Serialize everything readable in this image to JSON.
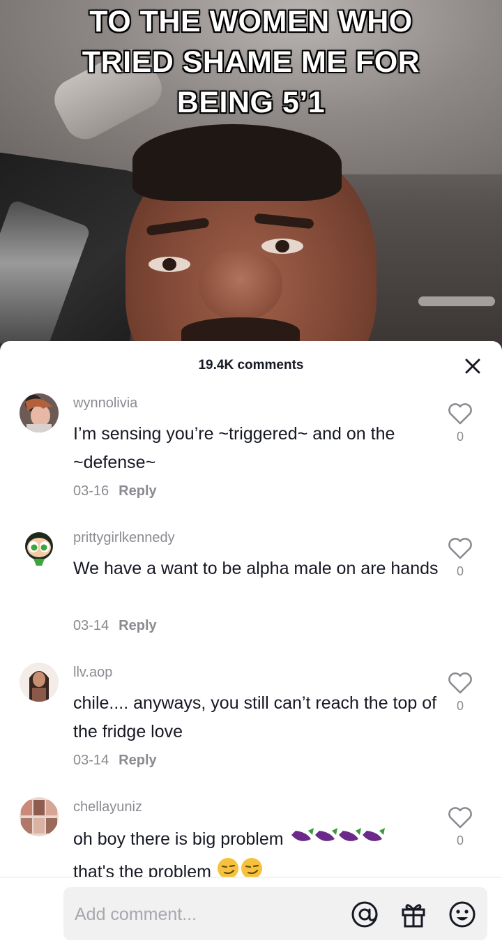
{
  "video": {
    "caption_lines": [
      "TO THE WOMEN WHO",
      "TRIED SHAME ME FOR",
      "BEING 5’1"
    ]
  },
  "comments_panel": {
    "count_label": "19.4K comments",
    "close_icon": "close-icon",
    "comments": [
      {
        "username": "wynnolivia",
        "text": "I’m sensing you’re ~triggered~ and on the ~defense~",
        "date": "03-16",
        "reply_label": "Reply",
        "likes": "0"
      },
      {
        "username": "prittygirlkennedy",
        "text": "We have a want to be alpha male on are hands",
        "date": "03-14",
        "reply_label": "Reply",
        "likes": "0"
      },
      {
        "username": "llv.aop",
        "text": "chile.... anyways, you still can’t reach the top of the fridge love",
        "date": "03-14",
        "reply_label": "Reply",
        "likes": "0"
      },
      {
        "username": "chellayuniz",
        "text_before": "oh boy there is big problem",
        "text_after": "that's the problem",
        "emoji_1": "eggplant-emoji",
        "emoji_2": "smirk-emoji",
        "likes": "0"
      }
    ]
  },
  "bottom_bar": {
    "placeholder": "Add comment...",
    "icons": [
      "at-icon",
      "gift-icon",
      "emoji-icon"
    ]
  },
  "colors": {
    "text_primary": "#161823",
    "text_secondary": "#8a8b91",
    "input_bg": "#f1f1f2"
  }
}
